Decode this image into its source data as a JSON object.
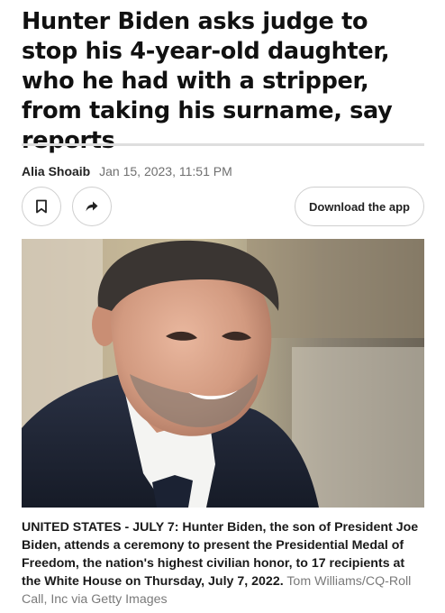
{
  "article": {
    "headline": "Hunter Biden asks judge to stop his 4-year-old daughter, who he had with a stripper, from taking his surname, say reports",
    "author": "Alia Shoaib",
    "date": "Jan 15, 2023, 11:51 PM"
  },
  "actions": {
    "bookmark_icon": "bookmark-icon",
    "share_icon": "share-arrow-icon",
    "download_label": "Download the app"
  },
  "photo": {
    "caption": "UNITED STATES - JULY 7: Hunter Biden, the son of President Joe Biden, attends a ceremony to present the Presidential Medal of Freedom, the nation's highest civilian honor, to 17 recipients at the White House on Thursday, July 7, 2022.",
    "credit": "Tom Williams/CQ-Roll Call, Inc via Getty Images"
  },
  "colors": {
    "text": "#111111",
    "muted": "#6f6f6f",
    "border": "#cfcfcf",
    "divider": "#dedede"
  }
}
